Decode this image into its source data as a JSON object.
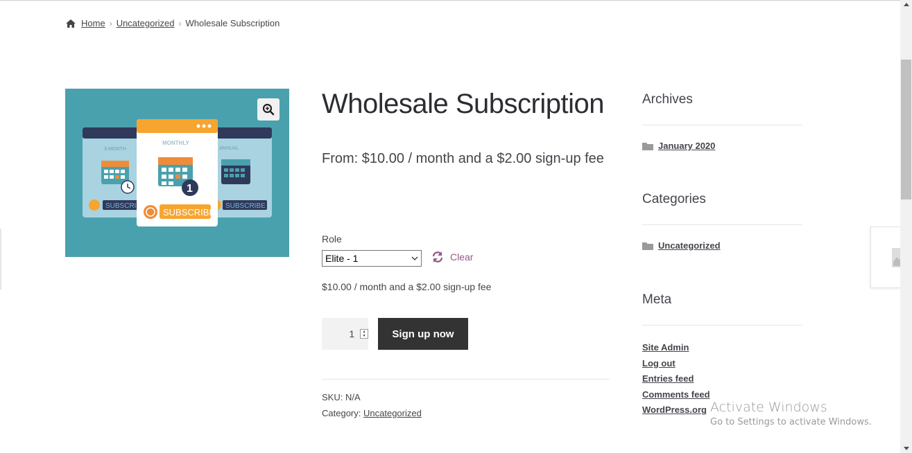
{
  "breadcrumb": {
    "home": "Home",
    "category": "Uncategorized",
    "current": "Wholesale Subscription",
    "separator": "›"
  },
  "product": {
    "title": "Wholesale Subscription",
    "price_from": "From: $10.00 / month and a $2.00 sign-up fee",
    "role_label": "Role",
    "role_selected": "Elite - 1",
    "clear_label": "Clear",
    "variation_price": "$10.00 / month and a $2.00 sign-up fee",
    "quantity": "1",
    "signup_button": "Sign up now",
    "sku_label": "SKU:",
    "sku_value": "N/A",
    "category_label": "Category:",
    "category_value": "Uncategorized",
    "image": {
      "left_card_label": "3-MONTH",
      "center_card_label": "MONTHLY",
      "right_card_label": "ANNUAL",
      "subscribe_text": "SUBSCRIBE",
      "badge_number": "1",
      "background_color": "#4aa1ae"
    }
  },
  "sidebar": {
    "archives": {
      "title": "Archives",
      "items": [
        "January 2020"
      ]
    },
    "categories": {
      "title": "Categories",
      "items": [
        "Uncategorized"
      ]
    },
    "meta": {
      "title": "Meta",
      "items": [
        "Site Admin",
        "Log out",
        "Entries feed",
        "Comments feed",
        "WordPress.org"
      ]
    }
  },
  "watermark": {
    "title": "Activate Windows",
    "subtitle": "Go to Settings to activate Windows."
  },
  "colors": {
    "accent": "#96588a",
    "button_bg": "#333333",
    "text": "#43454b"
  }
}
